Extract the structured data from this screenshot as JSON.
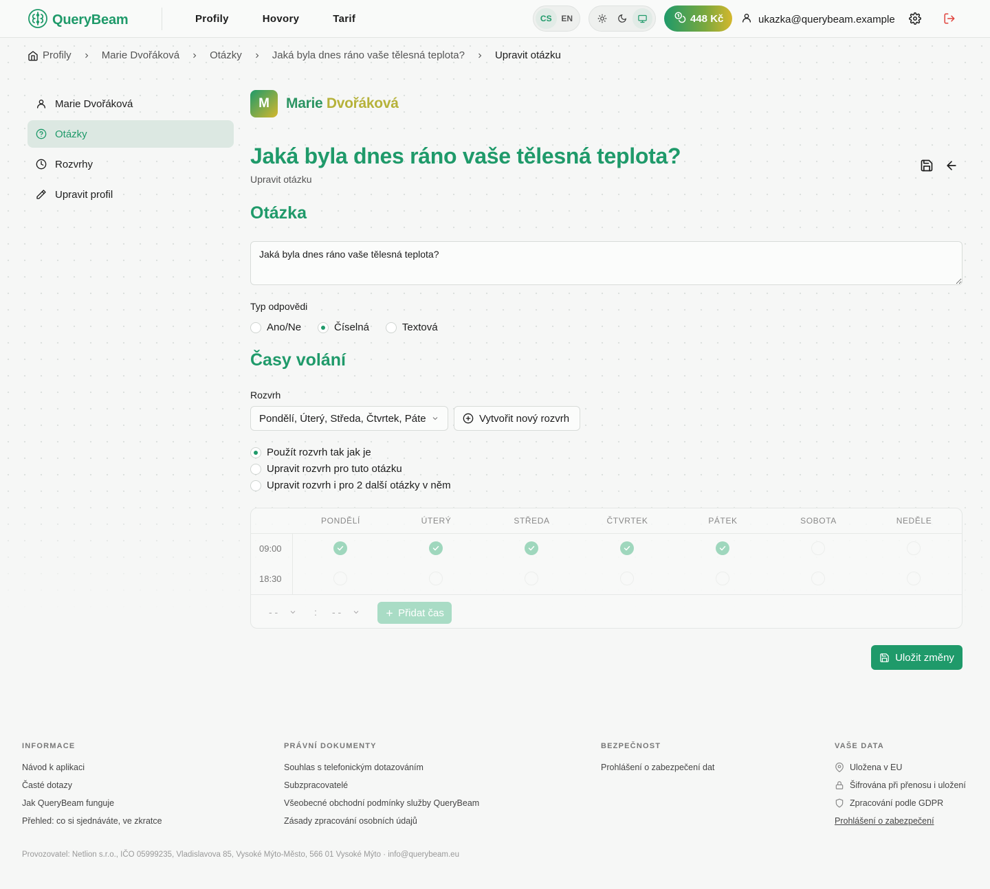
{
  "header": {
    "brand": "QueryBeam",
    "nav": [
      "Profily",
      "Hovory",
      "Tarif"
    ],
    "languages": [
      "CS",
      "EN"
    ],
    "active_language": "CS",
    "credit": "448 Kč",
    "user_email": "ukazka@querybeam.example",
    "icons": [
      "brain-logo-icon",
      "sun-icon",
      "moon-icon",
      "monitor-icon",
      "coins-icon",
      "user-icon",
      "gear-icon",
      "logout-icon"
    ]
  },
  "breadcrumb": [
    "Profily",
    "Marie Dvořáková",
    "Otázky",
    "Jaká byla dnes ráno vaše tělesná teplota?",
    "Upravit otázku"
  ],
  "sidebar": {
    "items": [
      {
        "label": "Marie Dvořáková",
        "icon": "user-icon"
      },
      {
        "label": "Otázky",
        "icon": "question-circle-icon"
      },
      {
        "label": "Rozvrhy",
        "icon": "clock-icon"
      },
      {
        "label": "Upravit profil",
        "icon": "pencil-icon"
      }
    ],
    "active_index": 1
  },
  "profile": {
    "initial": "M",
    "first_name": "Marie",
    "last_name": "Dvořáková"
  },
  "page": {
    "title": "Jaká byla dnes ráno vaše tělesná teplota?",
    "subtitle": "Upravit otázku"
  },
  "question_section": {
    "heading": "Otázka",
    "text_value": "Jaká byla dnes ráno vaše tělesná teplota?",
    "answer_type_label": "Typ odpovědi",
    "answer_types": [
      "Ano/Ne",
      "Číselná",
      "Textová"
    ],
    "selected_answer_type": "Číselná"
  },
  "schedule_section": {
    "heading": "Časy volání",
    "schedule_label": "Rozvrh",
    "schedule_value": "Pondělí, Úterý, Středa, Čtvrtek, Páte",
    "new_schedule_button": "Vytvořit nový rozvrh",
    "options": [
      "Použít rozvrh tak jak je",
      "Upravit rozvrh pro tuto otázku",
      "Upravit rozvrh i pro 2 další otázky v něm"
    ],
    "selected_option": 0,
    "days": [
      "PONDĚLÍ",
      "ÚTERÝ",
      "STŘEDA",
      "ČTVRTEK",
      "PÁTEK",
      "SOBOTA",
      "NEDĚLE"
    ],
    "rows": [
      {
        "time": "09:00",
        "checked": [
          true,
          true,
          true,
          true,
          true,
          false,
          false
        ]
      },
      {
        "time": "18:30",
        "checked": [
          false,
          false,
          false,
          false,
          false,
          false,
          false
        ]
      }
    ],
    "hour_placeholder": "- -",
    "minute_placeholder": "- -",
    "time_separator": ":",
    "add_time_button": "Přidat čas"
  },
  "save_button": "Uložit změny",
  "footer": {
    "columns": [
      {
        "heading": "Informace",
        "links": [
          "Návod k aplikaci",
          "Časté dotazy",
          "Jak QueryBeam funguje",
          "Přehled: co si sjednáváte, ve zkratce"
        ]
      },
      {
        "heading": "Právní dokumenty",
        "links": [
          "Souhlas s telefonickým dotazováním",
          "Subzpracovatelé",
          "Všeobecné obchodní podmínky služby QueryBeam",
          "Zásady zpracování osobních údajů"
        ]
      },
      {
        "heading": "Bezpečnost",
        "links": [
          "Prohlášení o zabezpečení dat"
        ]
      },
      {
        "heading": "Vaše data",
        "links": [
          "Uložena v EU",
          "Šifrována při přenosu i uložení",
          "Zpracování podle GDPR",
          "Prohlášení o zabezpečení"
        ]
      }
    ],
    "operator": "Provozovatel: Netlion s.r.o., IČO 05999235, Vladislavova 85, Vysoké Mýto-Město, 566 01 Vysoké Mýto · info@querybeam.eu"
  },
  "colors": {
    "accent": "#1f9a6a",
    "accent_light": "#dce8e2",
    "gold": "#d4b72d",
    "danger": "#e0413b"
  }
}
